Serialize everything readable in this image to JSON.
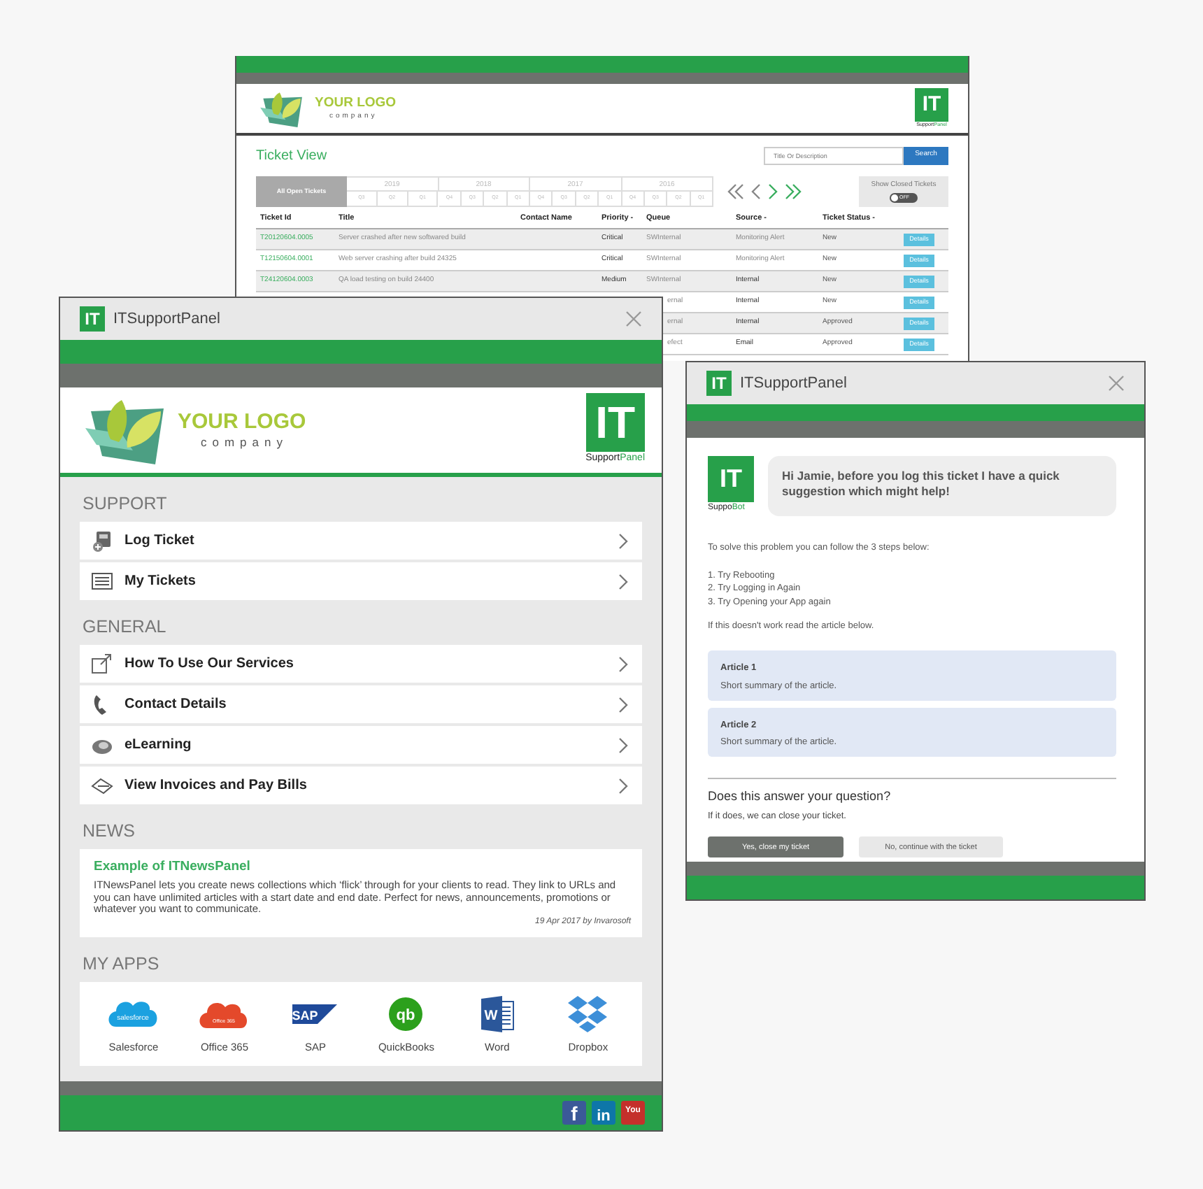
{
  "ticket_window": {
    "logo": {
      "name": "YOUR LOGO",
      "tagline": "company"
    },
    "brand": {
      "mark": "IT",
      "primary": "Support",
      "accent": "Panel"
    },
    "title": "Ticket View",
    "search": {
      "placeholder": "Title Or Description",
      "button": "Search"
    },
    "period_filter": {
      "all": {
        "label": "All Open Tickets",
        "selected": true
      },
      "years": [
        {
          "label": "2019",
          "quarters": [
            {
              "label": "Q3",
              "selected": false
            },
            {
              "label": "Q2",
              "selected": false
            },
            {
              "label": "Q1",
              "selected": false
            }
          ]
        },
        {
          "label": "2018",
          "quarters": [
            {
              "label": "Q4",
              "selected": false
            },
            {
              "label": "Q3",
              "selected": false
            },
            {
              "label": "Q2",
              "selected": false
            },
            {
              "label": "Q1",
              "selected": false
            }
          ]
        },
        {
          "label": "2017",
          "quarters": [
            {
              "label": "Q4",
              "selected": false
            },
            {
              "label": "Q3",
              "selected": false
            },
            {
              "label": "Q2",
              "selected": false
            },
            {
              "label": "Q1",
              "selected": false
            }
          ]
        },
        {
          "label": "2016",
          "quarters": [
            {
              "label": "Q4",
              "selected": false
            },
            {
              "label": "Q3",
              "selected": false
            },
            {
              "label": "Q2",
              "selected": false
            },
            {
              "label": "Q1",
              "selected": false
            }
          ]
        }
      ]
    },
    "pager": [
      {
        "kind": "first",
        "enabled": false
      },
      {
        "kind": "prev",
        "enabled": false
      },
      {
        "kind": "next",
        "enabled": true
      },
      {
        "kind": "last",
        "enabled": true
      }
    ],
    "closed_toggle": {
      "label": "Show Closed Tickets",
      "state_text": "OFF",
      "on": false
    },
    "columns": [
      "Ticket Id",
      "Title",
      "Contact Name",
      "Priority -",
      "Queue",
      "Source -",
      "Ticket Status -"
    ],
    "rows": [
      {
        "id": "T20120604.0005",
        "title": "Server crashed after new softwared build",
        "priority": "Critical",
        "queue": "SWInternal",
        "source": "Monitoring Alert",
        "status": "New",
        "action": "Details"
      },
      {
        "id": "T12150604.0001",
        "title": "Web server crashing after build 24325",
        "priority": "Critical",
        "queue": "SWInternal",
        "source": "Monitoring Alert",
        "status": "New",
        "action": "Details"
      },
      {
        "id": "T24120604.0003",
        "title": "QA load testing on build 24400",
        "priority": "Medium",
        "queue": "SWInternal",
        "source": "Internal",
        "status": "New",
        "action": "Details"
      },
      {
        "queue": "ernal",
        "source": "Internal",
        "status": "New",
        "action": "Details"
      },
      {
        "queue": "ernal",
        "source": "Internal",
        "status": "Approved",
        "action": "Details"
      },
      {
        "queue": "efect",
        "source": "Email",
        "status": "Approved",
        "action": "Details"
      }
    ]
  },
  "panel_window": {
    "title": {
      "mark": "IT",
      "text": "ITSupportPanel"
    },
    "logo": {
      "name": "YOUR LOGO",
      "tagline": "company"
    },
    "brand": {
      "mark": "IT",
      "primary": "Support",
      "accent": "Panel"
    },
    "sections": [
      {
        "heading": "SUPPORT",
        "items": [
          "Log Ticket",
          "My Tickets"
        ]
      },
      {
        "heading": "GENERAL",
        "items": [
          "How To Use Our Services",
          "Contact Details",
          "eLearning",
          "View Invoices and Pay Bills"
        ]
      }
    ],
    "news": {
      "heading": "NEWS",
      "title": "Example of ITNewsPanel",
      "body": "ITNewsPanel lets you create news collections which ‘flick’ through for your clients to read. They link to URLs and you can have unlimited articles with a start date and end date. Perfect for news, announcements, promotions or whatever you want to communicate.",
      "byline": "19 Apr 2017 by Invarosoft"
    },
    "apps": {
      "heading": "MY APPS",
      "items": [
        {
          "kind": "salesforce",
          "label": "Salesforce",
          "logo_text": "salesforce"
        },
        {
          "kind": "office",
          "label": "Office 365",
          "logo_text": "Office 365"
        },
        {
          "kind": "sap",
          "label": "SAP",
          "logo_text": "SAP"
        },
        {
          "kind": "quickbooks",
          "label": "QuickBooks",
          "logo_text": "qb"
        },
        {
          "kind": "word",
          "label": "Word",
          "logo_text": "W"
        },
        {
          "kind": "dropbox",
          "label": "Dropbox"
        }
      ]
    },
    "social": [
      {
        "kind": "facebook",
        "text": "f"
      },
      {
        "kind": "linkedin",
        "text": "in"
      },
      {
        "kind": "youtube",
        "text": "You"
      }
    ]
  },
  "bot_window": {
    "title": {
      "mark": "IT",
      "text": "ITSupportPanel"
    },
    "bot": {
      "mark": "IT",
      "primary": "Suppo",
      "accent": "Bot"
    },
    "message": "Hi Jamie, before you log this ticket I have a quick suggestion which might help!",
    "intro": "To solve this problem you can follow the 3 steps below:",
    "steps": [
      "1. Try Rebooting",
      "2. Try Logging in Again",
      "3. Try Opening your App again"
    ],
    "outro": "If this doesn't work read the article below.",
    "articles": [
      {
        "title": "Article 1",
        "summary": "Short summary of the article."
      },
      {
        "title": "Article 2",
        "summary": "Short summary of the article."
      }
    ],
    "question": "Does this answer your question?",
    "question_note": "If it does, we can close your ticket.",
    "buttons": [
      {
        "kind": "primary",
        "label": "Yes, close my ticket"
      },
      {
        "kind": "secondary",
        "label": "No, continue with the ticket"
      }
    ]
  }
}
